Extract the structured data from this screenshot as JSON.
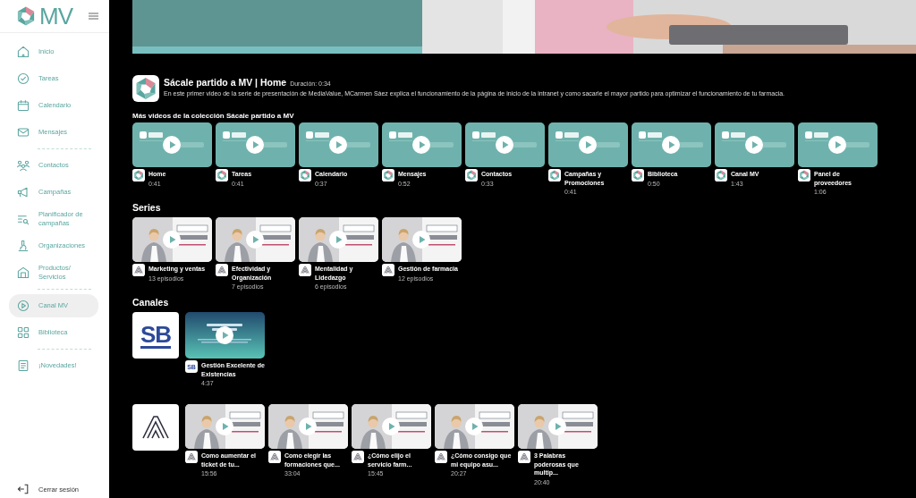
{
  "sidebar": {
    "logo": "MV",
    "groups": [
      [
        {
          "label": "Inicio",
          "selected": false
        },
        {
          "label": "Tareas",
          "selected": false
        },
        {
          "label": "Calendario",
          "selected": false
        },
        {
          "label": "Mensajes",
          "selected": false
        }
      ],
      [
        {
          "label": "Contactos",
          "selected": false
        },
        {
          "label": "Campañas",
          "selected": false
        },
        {
          "label": "Planificador de campañas",
          "selected": false
        },
        {
          "label": "Organizaciones",
          "selected": false
        },
        {
          "label": "Productos/ Servicios",
          "selected": false
        }
      ],
      [
        {
          "label": "Canal MV",
          "selected": true
        },
        {
          "label": "Biblioteca",
          "selected": false
        }
      ],
      [
        {
          "label": "¡Novedades!",
          "selected": false
        }
      ]
    ],
    "logout": "Cerrar sesión"
  },
  "featured": {
    "title": "Sácale partido a MV | Home",
    "duration": "Duración: 0:34",
    "description": "En este primer video de la serie de presentación de MediaValue, MCarmen Sáez explica el funcionamiento de la página de inicio de la intranet y como sacarle el mayor partido para optimizar el funcionamiento de tu farmacia."
  },
  "collection": {
    "heading": "Más videos de la colección Sácale partido a MV",
    "videos": [
      {
        "title": "Home",
        "duration": "0:41"
      },
      {
        "title": "Tareas",
        "duration": "0:41"
      },
      {
        "title": "Calendario",
        "duration": "0:37"
      },
      {
        "title": "Mensajes",
        "duration": "0:52"
      },
      {
        "title": "Contactos",
        "duration": "0:33"
      },
      {
        "title": "Campañas y Promociones",
        "duration": "0:41"
      },
      {
        "title": "Biblioteca",
        "duration": "0:50"
      },
      {
        "title": "Canal MV",
        "duration": "1:43"
      },
      {
        "title": "Panel de proveedores",
        "duration": "1:06"
      }
    ]
  },
  "series": {
    "heading": "Series",
    "items": [
      {
        "title": "Marketing y ventas",
        "episodes": "13 episodios"
      },
      {
        "title": "Efectividad y Organización",
        "episodes": "7 episodios"
      },
      {
        "title": "Mentalidad y Lidedazgo",
        "episodes": "6 episodios"
      },
      {
        "title": "Gestión de farmacia",
        "episodes": "12 episodios"
      }
    ]
  },
  "channels": {
    "heading": "Canales",
    "rows": [
      {
        "kind": "sb",
        "logo_text": "SB",
        "videos": [
          {
            "icon_text": "SB",
            "title": "Gestión Excelente de Existencias",
            "duration": "4:37"
          }
        ]
      },
      {
        "kind": "a",
        "videos": [
          {
            "title": "Como aumentar el ticket de tu...",
            "duration": "15:56"
          },
          {
            "title": "Como elegir las formaciones que...",
            "duration": "33:04"
          },
          {
            "title": "¿Cómo elijo el servicio farm...",
            "duration": "15:45"
          },
          {
            "title": "¿Cómo consigo que mi equipo asu...",
            "duration": "20:27"
          },
          {
            "title": "3 Palabras poderosas que multip...",
            "duration": "20:40"
          }
        ]
      }
    ]
  }
}
